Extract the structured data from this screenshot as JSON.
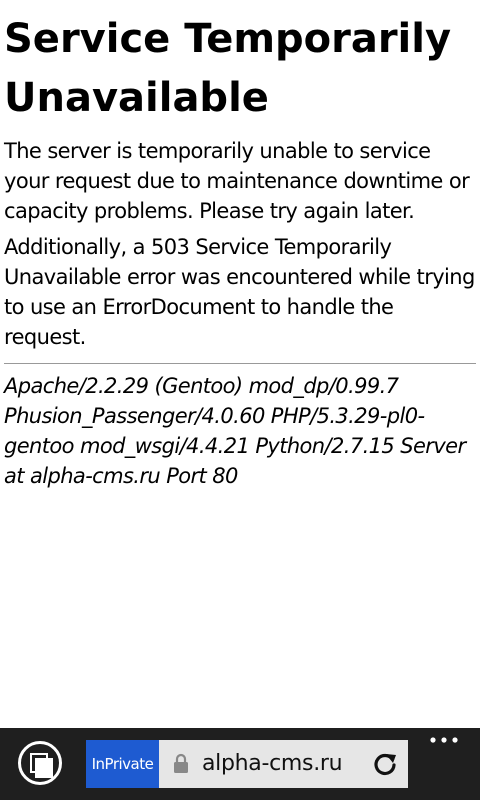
{
  "page": {
    "title": "Service Temporarily Unavailable",
    "paragraph1": "The server is temporarily unable to service your request due to maintenance downtime or capacity problems. Please try again later.",
    "paragraph2": "Additionally, a 503 Service Temporarily Unavailable error was encountered while trying to use an ErrorDocument to handle the request.",
    "signature": "Apache/2.2.29 (Gentoo) mod_dp/0.99.7 Phusion_Passenger/4.0.60 PHP/5.3.29-pl0-gentoo mod_wsgi/4.4.21 Python/2.7.15 Server at alpha-cms.ru Port 80"
  },
  "browser": {
    "inprivate_label": "InPrivate",
    "url": "alpha-cms.ru",
    "icons": {
      "tabs": "tabs-icon",
      "lock": "lock-icon",
      "refresh": "refresh-icon",
      "more": "more-icon"
    },
    "colors": {
      "appbar": "#1f1f1f",
      "inprivate": "#1e5bd1",
      "addressbar": "#e6e6e6"
    }
  }
}
